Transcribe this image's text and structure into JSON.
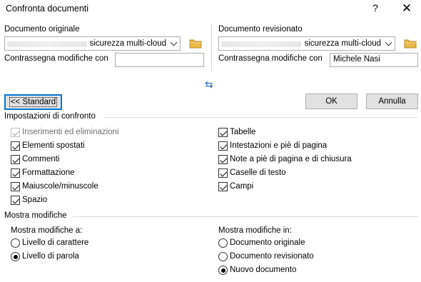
{
  "window": {
    "title": "Confronta documenti",
    "help": "?",
    "close": "✕"
  },
  "original": {
    "label": "Documento originale",
    "file_value": "sicurezza multi-cloud",
    "track_label": "Contrassegna modifiche con",
    "track_value": ""
  },
  "revised": {
    "label": "Documento revisionato",
    "file_value": "sicurezza multi-cloud",
    "track_label": "Contrassegna modifiche con",
    "track_value": "Michele Nasi"
  },
  "swap_icon": "⇆",
  "buttons": {
    "standard": "<< Standard",
    "ok": "OK",
    "cancel": "Annulla"
  },
  "comparison": {
    "title": "Impostazioni di confronto",
    "left": [
      {
        "label": "Inserimenti ed eliminazioni",
        "checked": true,
        "disabled": true
      },
      {
        "label": "Elementi spostati",
        "checked": true,
        "disabled": false
      },
      {
        "label": "Commenti",
        "checked": true,
        "disabled": false
      },
      {
        "label": "Formattazione",
        "checked": true,
        "disabled": false
      },
      {
        "label": "Maiuscole/minuscole",
        "checked": true,
        "disabled": false
      },
      {
        "label": "Spazio",
        "checked": true,
        "disabled": false
      }
    ],
    "right": [
      {
        "label": "Tabelle",
        "checked": true
      },
      {
        "label": "Intestazioni e piè di pagina",
        "checked": true
      },
      {
        "label": "Note a piè di pagina e di chiusura",
        "checked": true
      },
      {
        "label": "Caselle di testo",
        "checked": true
      },
      {
        "label": "Campi",
        "checked": true
      }
    ]
  },
  "show": {
    "title": "Mostra modifiche",
    "at_label": "Mostra modifiche a:",
    "at_options": [
      {
        "label": "Livello di carattere",
        "selected": false
      },
      {
        "label": "Livello di parola",
        "selected": true
      }
    ],
    "in_label": "Mostra modifiche in:",
    "in_options": [
      {
        "label": "Documento originale",
        "selected": false
      },
      {
        "label": "Documento revisionato",
        "selected": false
      },
      {
        "label": "Nuovo documento",
        "selected": true
      }
    ]
  }
}
